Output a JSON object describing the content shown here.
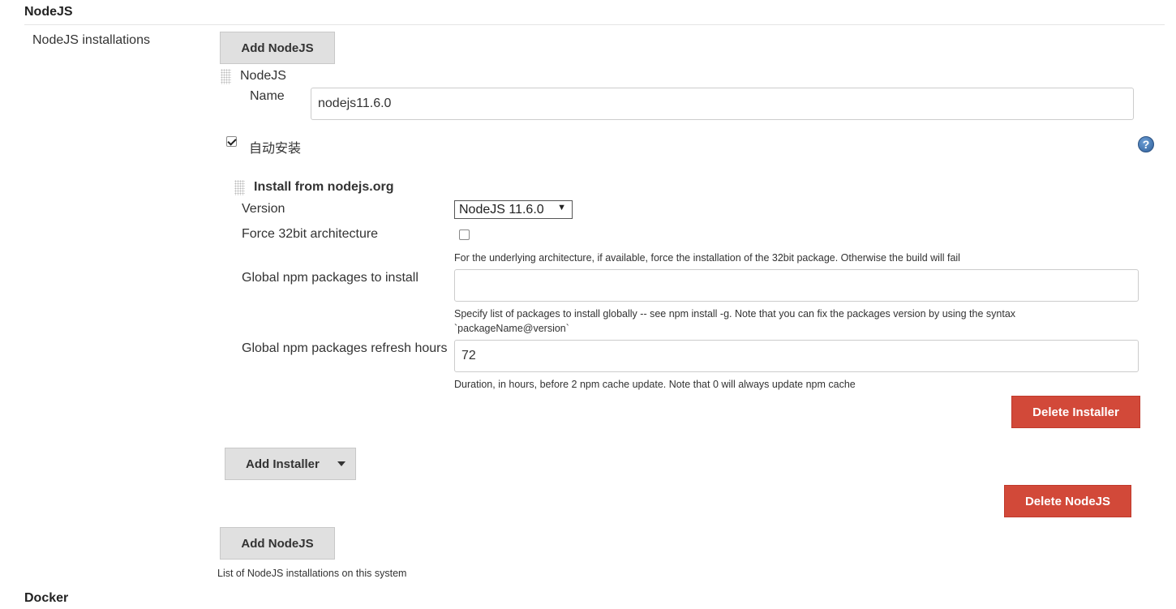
{
  "nodejs_section": {
    "title": "NodeJS",
    "installations_label": "NodeJS installations",
    "add_nodejs_top": "Add NodeJS",
    "installation": {
      "header": "NodeJS",
      "name_label": "Name",
      "name_value": "nodejs11.6.0",
      "auto_install_label": "自动安装",
      "auto_install_checked": true,
      "installer": {
        "header": "Install from nodejs.org",
        "version_label": "Version",
        "version_value": "NodeJS 11.6.0",
        "force32_label": "Force 32bit architecture",
        "force32_checked": false,
        "force32_help": "For the underlying architecture, if available, force the installation of the 32bit package. Otherwise the build will fail",
        "npm_packages_label": "Global npm packages to install",
        "npm_packages_value": "",
        "npm_packages_help_line1": "Specify list of packages to install globally -- see npm install -g. Note that you can fix the packages version by using the syntax",
        "npm_packages_help_line2": "`packageName@version`",
        "refresh_label": "Global npm packages refresh hours",
        "refresh_value": "72",
        "refresh_help": "Duration, in hours, before 2 npm cache update. Note that 0 will always update npm cache",
        "delete_installer": "Delete Installer"
      },
      "add_installer": "Add Installer",
      "delete_nodejs": "Delete NodeJS"
    },
    "add_nodejs_bottom": "Add NodeJS",
    "list_help": "List of NodeJS installations on this system"
  },
  "docker_section": {
    "title": "Docker"
  },
  "icons": {
    "help": "help-icon",
    "drag": "drag-handle-icon",
    "dropdown": "chevron-down-icon"
  },
  "colors": {
    "danger": "#d24939",
    "button_gray": "#e0e0e0",
    "help_blue": "#3b6fb0"
  }
}
